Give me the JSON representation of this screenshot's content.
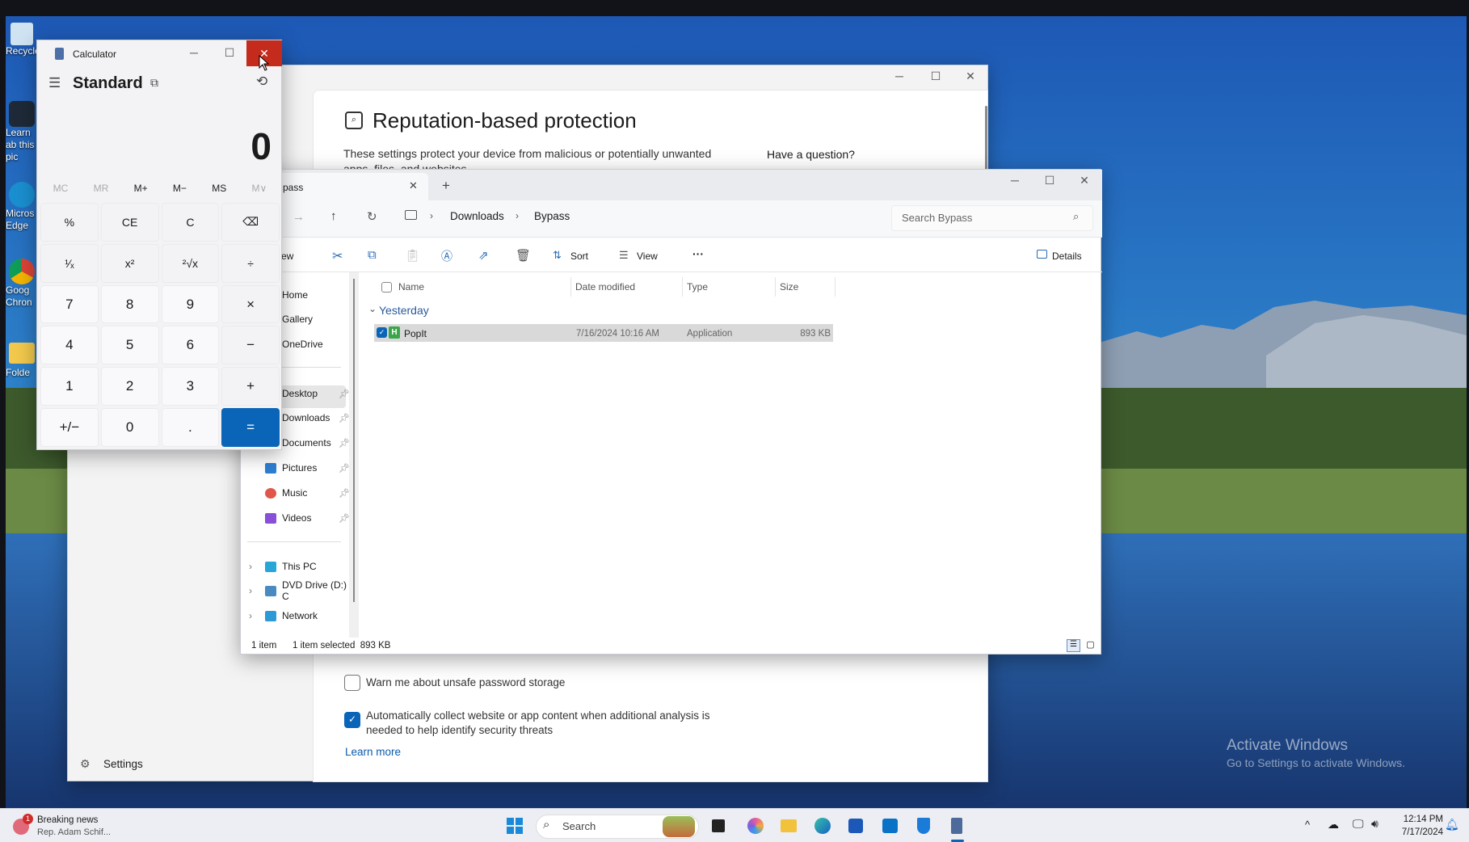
{
  "desktop": {
    "icons": [
      {
        "label": "Recycle",
        "icon": "recycle-bin-icon"
      },
      {
        "label": "Learn ab this pic",
        "icon": "learn-picture-icon"
      },
      {
        "label": "Micros Edge",
        "icon": "edge-icon"
      },
      {
        "label": "Goog Chron",
        "icon": "chrome-icon"
      },
      {
        "label": "Folde",
        "icon": "folder-icon"
      }
    ],
    "watermark": {
      "title": "Activate Windows",
      "subtitle": "Go to Settings to activate Windows."
    }
  },
  "security_window": {
    "title": "Reputation-based protection",
    "description": "These settings protect your device from malicious or potentially unwanted apps, files, and websites.",
    "help_heading": "Have a question?",
    "options": [
      {
        "label": "Warn me about unsafe password storage",
        "checked": false
      },
      {
        "label": "Automatically collect website or app content when additional analysis is needed to help identify security threats",
        "checked": true
      }
    ],
    "learn_more": "Learn more",
    "settings_label": "Settings"
  },
  "explorer": {
    "tab_label": "pass",
    "breadcrumb": [
      "Downloads",
      "Bypass"
    ],
    "search_placeholder": "Search Bypass",
    "toolbar": {
      "new_label": "ew",
      "sort": "Sort",
      "view": "View",
      "more": "···",
      "details": "Details"
    },
    "sidebar": {
      "quick": [
        {
          "label": "Home"
        },
        {
          "label": "Gallery"
        },
        {
          "label": "OneDrive"
        }
      ],
      "pinned": [
        {
          "label": "Desktop"
        },
        {
          "label": "Downloads",
          "selected": true
        },
        {
          "label": "Documents"
        },
        {
          "label": "Pictures"
        },
        {
          "label": "Music"
        },
        {
          "label": "Videos"
        }
      ],
      "locations": [
        {
          "label": "This PC"
        },
        {
          "label": "DVD Drive (D:) C"
        },
        {
          "label": "Network"
        }
      ]
    },
    "columns": [
      "Name",
      "Date modified",
      "Type",
      "Size"
    ],
    "group": "Yesterday",
    "files": [
      {
        "name": "PopIt",
        "date": "7/16/2024 10:16 AM",
        "type": "Application",
        "size": "893 KB",
        "selected": true
      }
    ],
    "status": {
      "count": "1 item",
      "selected": "1 item selected  893 KB"
    }
  },
  "calculator": {
    "title": "Calculator",
    "mode": "Standard",
    "display": "0",
    "memory": [
      "MC",
      "MR",
      "M+",
      "M−",
      "MS",
      "M∨"
    ],
    "keys": [
      "%",
      "CE",
      "C",
      "⌫",
      "¹⁄ₓ",
      "x²",
      "²√x",
      "÷",
      "7",
      "8",
      "9",
      "×",
      "4",
      "5",
      "6",
      "−",
      "1",
      "2",
      "3",
      "+",
      "+/−",
      "0",
      ".",
      "="
    ]
  },
  "taskbar": {
    "news_title": "Breaking news",
    "news_sub": "Rep. Adam Schif...",
    "news_badge": "1",
    "search": "Search",
    "time": "12:14 PM",
    "date": "7/17/2024"
  },
  "colors": {
    "accent": "#0a65b8",
    "close_hover": "#c42b1c",
    "link": "#0b5cad"
  }
}
